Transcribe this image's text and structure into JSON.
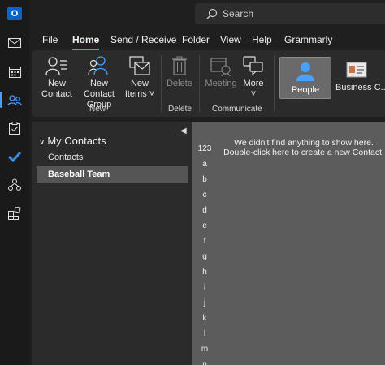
{
  "colors": {
    "accent": "#4aa0ff",
    "outlook_blue": "#0a64c8",
    "todo_blue": "#3a8ee6"
  },
  "rail": {
    "logo_letter": "O",
    "items": [
      "mail-icon",
      "calendar-icon",
      "people-icon",
      "tasks-icon",
      "todo-icon",
      "groups-icon",
      "apps-icon"
    ]
  },
  "search": {
    "placeholder": "Search"
  },
  "menu": {
    "tabs": [
      "File",
      "Home",
      "Send / Receive",
      "Folder",
      "View",
      "Help",
      "Grammarly"
    ],
    "active": "Home"
  },
  "ribbon": {
    "new_contact": "New\nContact",
    "new_contact_group": "New Contact\nGroup",
    "new_items": "New\nItems ˅",
    "group_new": "New",
    "delete": "Delete",
    "group_delete": "Delete",
    "meeting": "Meeting",
    "more": "More\n˅",
    "group_communicate": "Communicate",
    "people": "People",
    "business_card": "Business C..."
  },
  "folders": {
    "header": "My Contacts",
    "items": [
      {
        "label": "Contacts",
        "selected": false
      },
      {
        "label": "Baseball Team",
        "selected": true
      }
    ]
  },
  "content": {
    "empty_line1": "We didn't find anything to show here.",
    "empty_line2": "Double-click here to create a new Contact.",
    "letters": [
      "123",
      "a",
      "b",
      "c",
      "d",
      "e",
      "f",
      "g",
      "h",
      "i",
      "j",
      "k",
      "l",
      "m",
      "n"
    ]
  }
}
